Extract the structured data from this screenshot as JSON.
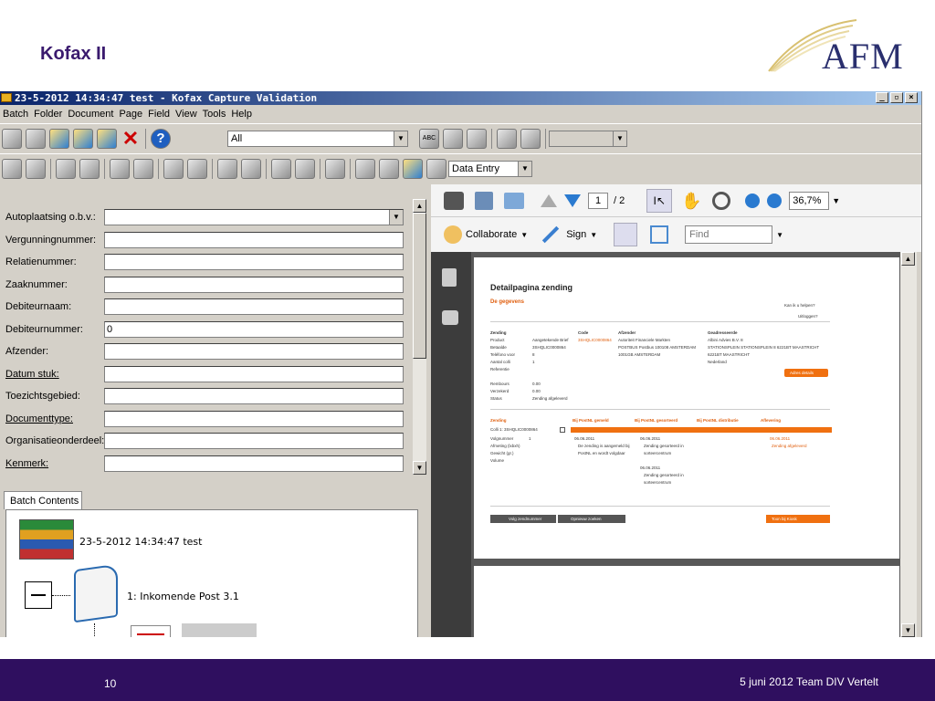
{
  "slide": {
    "title": "Kofax II",
    "logo_text": "AFM",
    "page_number": "10",
    "footer_note": "5 juni 2012 Team DIV Vertelt"
  },
  "window": {
    "title": "23-5-2012 14:34:47 test - Kofax Capture Validation",
    "minimize": "_",
    "restore": "▫",
    "close": "×"
  },
  "menu": [
    "Batch",
    "Folder",
    "Document",
    "Page",
    "Field",
    "View",
    "Tools",
    "Help"
  ],
  "toolbar": {
    "filter_value": "All",
    "mode_value": "Data Entry",
    "abc_label": "ABC"
  },
  "fields": [
    {
      "label": "Autoplaatsing o.b.v.:",
      "value": "",
      "underline": false,
      "dropdown": true
    },
    {
      "label": "Vergunningnummer:",
      "value": "",
      "underline": false
    },
    {
      "label": "Relatienummer:",
      "value": "",
      "underline": false
    },
    {
      "label": "Zaaknummer:",
      "value": "",
      "underline": false
    },
    {
      "label": "Debiteurnaam:",
      "value": "",
      "underline": false
    },
    {
      "label": "Debiteurnummer:",
      "value": "0",
      "underline": false
    },
    {
      "label": "Afzender:",
      "value": "",
      "underline": false
    },
    {
      "label": "Datum stuk:",
      "value": "",
      "underline": true
    },
    {
      "label": "Toezichtsgebied:",
      "value": "",
      "underline": false
    },
    {
      "label": "Documenttype:",
      "value": "",
      "underline": true
    },
    {
      "label": "Organisatieonderdeel:",
      "value": "",
      "underline": false
    },
    {
      "label": "Kenmerk:",
      "value": "",
      "underline": true
    }
  ],
  "batch": {
    "tab": "Batch Contents",
    "root": "23-5-2012 14:34:47 test",
    "folder": "1: Inkomende Post 3.1"
  },
  "pdf": {
    "page_current": "1",
    "page_total": "/ 2",
    "zoom": "36,7%",
    "collaborate": "Collaborate",
    "sign": "Sign",
    "find_placeholder": "Find",
    "doc": {
      "heading": "Detailpagina zending",
      "subheading": "De gegevens",
      "help": "Kan ik u helpen?",
      "logout": "Uitloggen?",
      "col_zending": "Zending",
      "col_code": "Code",
      "col_afzender": "Afzender",
      "col_geadresseerde": "Geadresseerde",
      "rows": [
        [
          "Product",
          "Aangetekende Brief",
          "3SHQLIC0000864",
          "Autoriteit Financiele Markten",
          "Albini Advies B.V. 8"
        ],
        [
          "Betaalde",
          "3SHQLIC0000864",
          "",
          "POSTBUS Postbus 100108 AMSTERDAM",
          "STATIONSPLEIN STATIONSPLEIN 8 6221BT MAASTRICHT"
        ],
        [
          "Teléfono voor",
          "8",
          "",
          "1001GB AMSTERDAM",
          "6221BT MAASTRICHT"
        ],
        [
          "Aantal colli",
          "1",
          "",
          "",
          "Nederland"
        ],
        [
          "Referentie",
          "",
          "",
          "",
          ""
        ]
      ],
      "adres_button": "Adres details",
      "rembours": "Rembours",
      "rembours_val": "0.00",
      "verzekerd": "Verzekerd",
      "verzekerd_val": "0.00",
      "status": "Status",
      "status_val": "Zending afgeleverd",
      "tracking": [
        "Zending",
        "Bij PostNL gemeld",
        "Bij PostNL gesorteerd",
        "Bij PostNL distributie",
        "Aflevering"
      ],
      "colli": "Colli 1: 3SHQLIC0000864",
      "volgnummer": "Volgnummer",
      "volg_val": "1",
      "afmeting": "Afmeting (lxbxh)",
      "gewicht": "Gewicht (gr.)",
      "volume": "Volume",
      "date1": "06.06.2011",
      "msg1a": "De zending is aangemeld bij",
      "msg1b": "PostNL en wordt volgdaar",
      "date2": "06.06.2011",
      "msg2a": "Zending gesorteerd in",
      "msg2b": "sorteercentrum",
      "date3": "06.06.2011",
      "msg3a": "Zending gesorteerd in",
      "msg3b": "sorteercentrum",
      "date4": "06.06.2011",
      "msg4": "Zending afgeleverd",
      "btn_volg": "Volg zendnummer",
      "btn_opnieuw": "Opnieuw zoeken",
      "btn_toon": "Toon bij Kiosk"
    }
  }
}
